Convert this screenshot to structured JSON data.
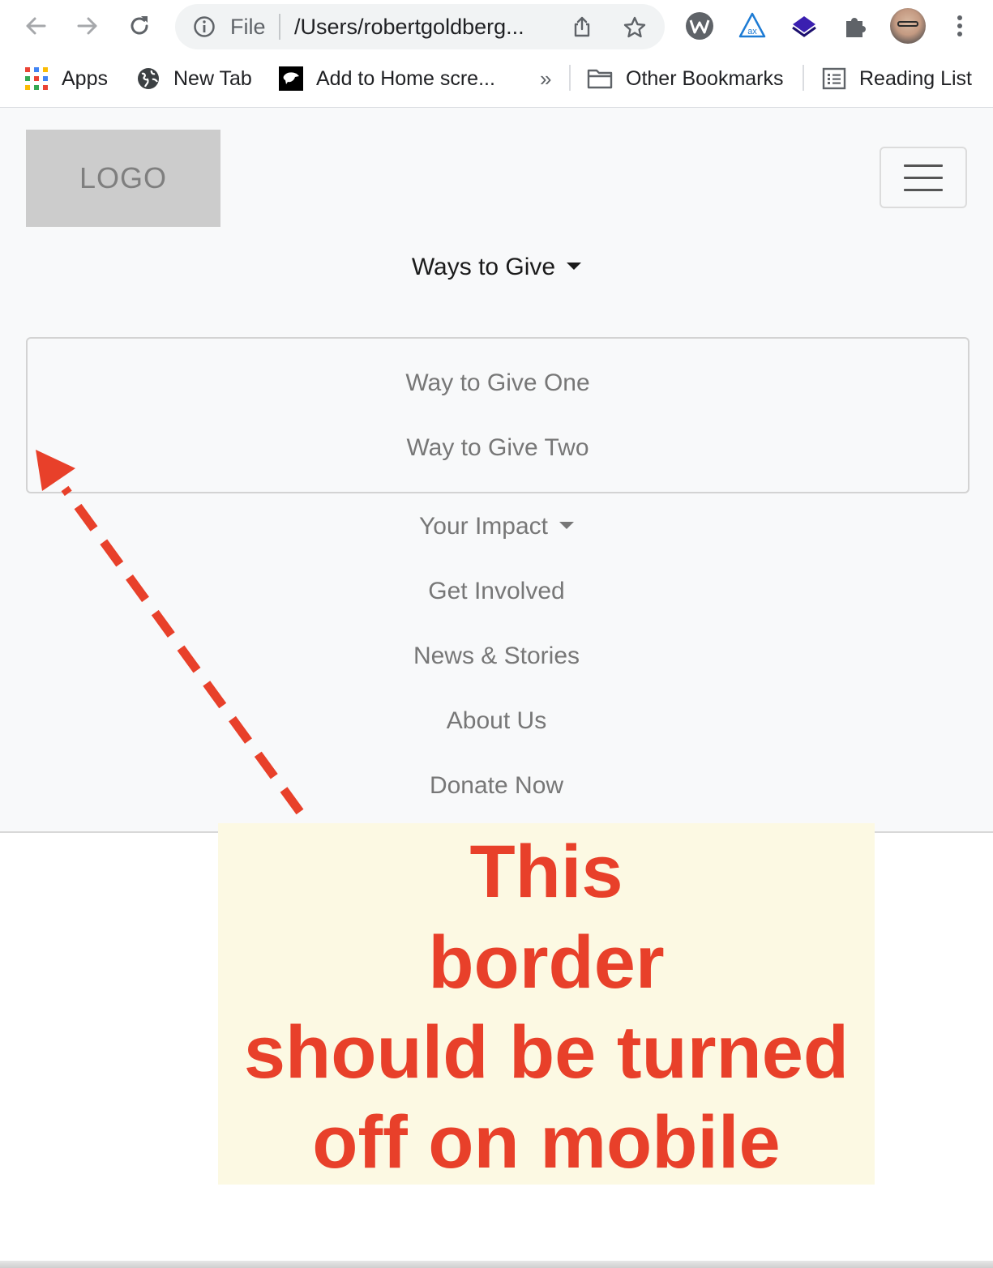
{
  "browser": {
    "omnibox": {
      "scheme_label": "File",
      "url": "/Users/robertgoldberg..."
    },
    "bookmarks": {
      "apps": "Apps",
      "new_tab": "New Tab",
      "add_home": "Add to Home scre...",
      "overflow": "»",
      "other": "Other Bookmarks",
      "reading": "Reading List"
    }
  },
  "page": {
    "logo": "LOGO",
    "nav": {
      "ways_to_give": "Ways to Give",
      "dropdown": [
        "Way to Give One",
        "Way to Give Two"
      ],
      "your_impact": "Your Impact",
      "get_involved": "Get Involved",
      "news": "News & Stories",
      "about": "About Us",
      "donate": "Donate Now"
    }
  },
  "annotation": {
    "lines": [
      "This",
      "border",
      "should be turned",
      "off on mobile"
    ],
    "color": "#e8402a",
    "background": "#fcf9e3"
  }
}
